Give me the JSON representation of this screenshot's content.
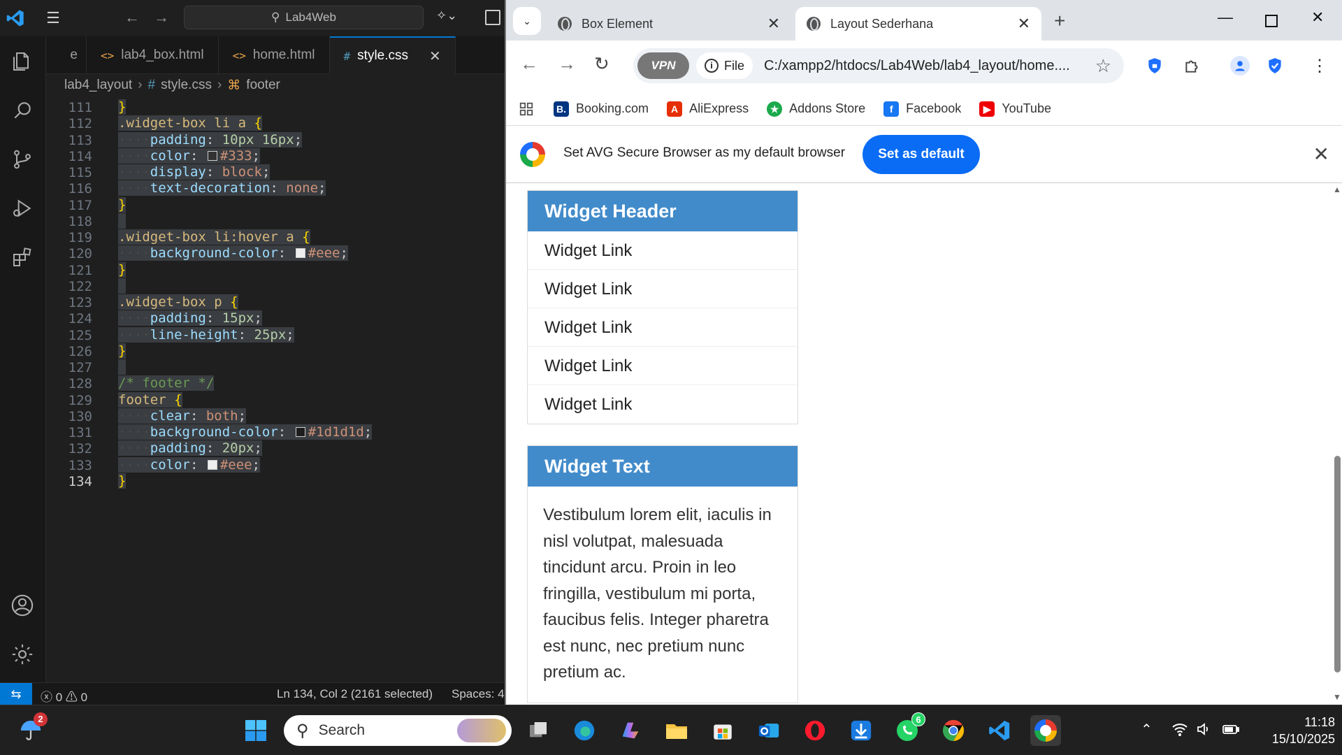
{
  "vscode": {
    "search": "Lab4Web",
    "tabs": [
      {
        "label": "lab4_box.html",
        "icon": "<>"
      },
      {
        "label": "home.html",
        "icon": "<>"
      },
      {
        "label": "style.css",
        "icon": "#"
      }
    ],
    "breadcrumb": {
      "folder": "lab4_layout",
      "file": "style.css",
      "symbol": "footer"
    },
    "lines": [
      {
        "n": "111",
        "h": [
          [
            "c-br",
            "}"
          ]
        ]
      },
      {
        "n": "112",
        "h": [
          [
            "c-sel",
            ".widget-box li a "
          ],
          [
            "c-br",
            "{"
          ]
        ]
      },
      {
        "n": "113",
        "h": [
          [
            "ind",
            ""
          ],
          [
            "c-prop",
            "padding"
          ],
          [
            "c-p",
            ": "
          ],
          [
            "c-num",
            "10px 16px"
          ],
          [
            "c-p",
            ";"
          ]
        ]
      },
      {
        "n": "114",
        "h": [
          [
            "ind",
            ""
          ],
          [
            "c-prop",
            "color"
          ],
          [
            "c-p",
            ": "
          ],
          [
            "sw",
            "#333"
          ],
          [
            "c-val",
            "#333"
          ],
          [
            "c-p",
            ";"
          ]
        ]
      },
      {
        "n": "115",
        "h": [
          [
            "ind",
            ""
          ],
          [
            "c-prop",
            "display"
          ],
          [
            "c-p",
            ": "
          ],
          [
            "c-val",
            "block"
          ],
          [
            "c-p",
            ";"
          ]
        ]
      },
      {
        "n": "116",
        "h": [
          [
            "ind",
            ""
          ],
          [
            "c-prop",
            "text-decoration"
          ],
          [
            "c-p",
            ": "
          ],
          [
            "c-val",
            "none"
          ],
          [
            "c-p",
            ";"
          ]
        ]
      },
      {
        "n": "117",
        "h": [
          [
            "c-br",
            "}"
          ]
        ]
      },
      {
        "n": "118",
        "h": []
      },
      {
        "n": "119",
        "h": [
          [
            "c-sel",
            ".widget-box li:hover a "
          ],
          [
            "c-br",
            "{"
          ]
        ]
      },
      {
        "n": "120",
        "h": [
          [
            "ind",
            ""
          ],
          [
            "c-prop",
            "background-color"
          ],
          [
            "c-p",
            ": "
          ],
          [
            "sw",
            "#eee"
          ],
          [
            "c-val",
            "#eee"
          ],
          [
            "c-p",
            ";"
          ]
        ]
      },
      {
        "n": "121",
        "h": [
          [
            "c-br",
            "}"
          ]
        ]
      },
      {
        "n": "122",
        "h": []
      },
      {
        "n": "123",
        "h": [
          [
            "c-sel",
            ".widget-box p "
          ],
          [
            "c-br",
            "{"
          ]
        ]
      },
      {
        "n": "124",
        "h": [
          [
            "ind",
            ""
          ],
          [
            "c-prop",
            "padding"
          ],
          [
            "c-p",
            ": "
          ],
          [
            "c-num",
            "15px"
          ],
          [
            "c-p",
            ";"
          ]
        ]
      },
      {
        "n": "125",
        "h": [
          [
            "ind",
            ""
          ],
          [
            "c-prop",
            "line-height"
          ],
          [
            "c-p",
            ": "
          ],
          [
            "c-num",
            "25px"
          ],
          [
            "c-p",
            ";"
          ]
        ]
      },
      {
        "n": "126",
        "h": [
          [
            "c-br",
            "}"
          ]
        ]
      },
      {
        "n": "127",
        "h": []
      },
      {
        "n": "128",
        "h": [
          [
            "c-cm",
            "/* footer */"
          ]
        ]
      },
      {
        "n": "129",
        "h": [
          [
            "c-sel",
            "footer "
          ],
          [
            "c-br",
            "{"
          ]
        ]
      },
      {
        "n": "130",
        "h": [
          [
            "ind",
            ""
          ],
          [
            "c-prop",
            "clear"
          ],
          [
            "c-p",
            ": "
          ],
          [
            "c-val",
            "both"
          ],
          [
            "c-p",
            ";"
          ]
        ]
      },
      {
        "n": "131",
        "h": [
          [
            "ind",
            ""
          ],
          [
            "c-prop",
            "background-color"
          ],
          [
            "c-p",
            ": "
          ],
          [
            "sw",
            "#1d1d1d"
          ],
          [
            "c-val",
            "#1d1d1d"
          ],
          [
            "c-p",
            ";"
          ]
        ]
      },
      {
        "n": "132",
        "h": [
          [
            "ind",
            ""
          ],
          [
            "c-prop",
            "padding"
          ],
          [
            "c-p",
            ": "
          ],
          [
            "c-num",
            "20px"
          ],
          [
            "c-p",
            ";"
          ]
        ]
      },
      {
        "n": "133",
        "h": [
          [
            "ind",
            ""
          ],
          [
            "c-prop",
            "color"
          ],
          [
            "c-p",
            ": "
          ],
          [
            "sw",
            "#eee"
          ],
          [
            "c-val",
            "#eee"
          ],
          [
            "c-p",
            ";"
          ]
        ]
      },
      {
        "n": "134",
        "h": [
          [
            "c-br",
            "}"
          ]
        ]
      }
    ],
    "status": {
      "errors": "0",
      "warnings": "0",
      "position": "Ln 134, Col 2 (2161 selected)",
      "spaces": "Spaces: 4"
    }
  },
  "browser": {
    "tabs": [
      {
        "label": "Box Element"
      },
      {
        "label": "Layout Sederhana"
      }
    ],
    "vpn": "VPN",
    "file_label": "File",
    "url": "C:/xampp2/htdocs/Lab4Web/lab4_layout/home....",
    "bookmarks": [
      {
        "label": "Booking.com",
        "icon": "B.",
        "color": "#003580"
      },
      {
        "label": "AliExpress",
        "icon": "A",
        "color": "#e62e04"
      },
      {
        "label": "Addons Store",
        "icon": "★",
        "color": "#1ba94c"
      },
      {
        "label": "Facebook",
        "icon": "f",
        "color": "#1877f2"
      },
      {
        "label": "YouTube",
        "icon": "▶",
        "color": "#e00"
      }
    ],
    "infobar": {
      "text": "Set AVG Secure Browser as my default browser",
      "button": "Set as default"
    }
  },
  "page": {
    "widget1": {
      "header": "Widget Header",
      "links": [
        "Widget Link",
        "Widget Link",
        "Widget Link",
        "Widget Link",
        "Widget Link"
      ]
    },
    "widget2": {
      "header": "Widget Text",
      "text": "Vestibulum lorem elit, iaculis in nisl volutpat, malesuada tincidunt arcu. Proin in leo fringilla, vestibulum mi porta, faucibus felis. Integer pharetra est nunc, nec pretium nunc pretium ac."
    }
  },
  "taskbar": {
    "search": "Search",
    "notif_count": "2",
    "whatsapp_count": "6",
    "time": "11:18",
    "date": "15/10/2025"
  }
}
